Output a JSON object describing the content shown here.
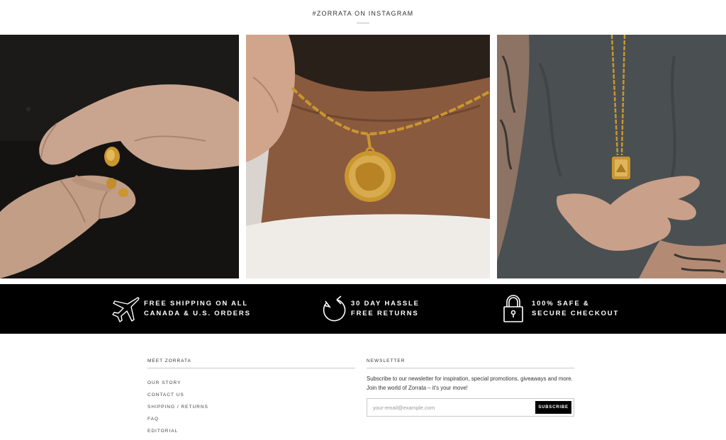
{
  "instagram": {
    "title": "#ZORRATA ON INSTAGRAM",
    "photos": [
      {
        "icon": "hands-gold-rings-photo"
      },
      {
        "icon": "neck-gold-chain-medallion-photo"
      },
      {
        "icon": "man-gold-pendant-photo"
      }
    ]
  },
  "features": [
    {
      "icon": "airplane-icon",
      "line1": "FREE SHIPPING ON ALL",
      "line2": "CANADA & U.S. ORDERS"
    },
    {
      "icon": "return-arrow-icon",
      "line1": "30 DAY HASSLE",
      "line2": "FREE RETURNS"
    },
    {
      "icon": "padlock-icon",
      "line1": "100% SAFE &",
      "line2": "SECURE CHECKOUT"
    }
  ],
  "footer": {
    "meet": {
      "heading": "MEET ZORRATA",
      "links": [
        "OUR STORY",
        "CONTACT US",
        "SHIPPING / RETURNS",
        "FAQ",
        "EDITORIAL"
      ]
    },
    "newsletter": {
      "heading": "NEWSLETTER",
      "description": "Subscribe to our newsletter for inspiration, special promotions, giveaways and more. Join the world of Zorrata – it's your move!",
      "placeholder": "your-email@example.com",
      "button": "SUBSCRIBE"
    }
  },
  "colors": {
    "feature_bar": "#000000",
    "gold": "#c9962f",
    "text": "#222222"
  }
}
